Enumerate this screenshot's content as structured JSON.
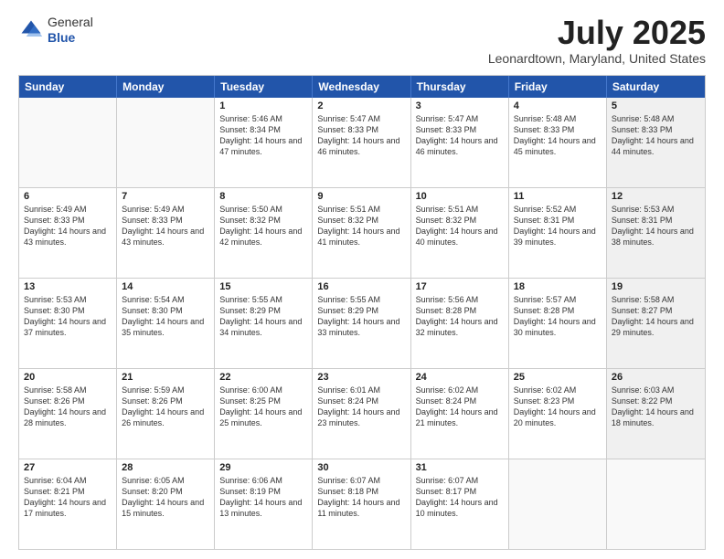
{
  "logo": {
    "general": "General",
    "blue": "Blue"
  },
  "title": {
    "month": "July 2025",
    "location": "Leonardtown, Maryland, United States"
  },
  "header_days": [
    "Sunday",
    "Monday",
    "Tuesday",
    "Wednesday",
    "Thursday",
    "Friday",
    "Saturday"
  ],
  "weeks": [
    [
      {
        "day": "",
        "sunrise": "",
        "sunset": "",
        "daylight": "",
        "empty": true
      },
      {
        "day": "",
        "sunrise": "",
        "sunset": "",
        "daylight": "",
        "empty": true
      },
      {
        "day": "1",
        "sunrise": "Sunrise: 5:46 AM",
        "sunset": "Sunset: 8:34 PM",
        "daylight": "Daylight: 14 hours and 47 minutes.",
        "empty": false,
        "shaded": false
      },
      {
        "day": "2",
        "sunrise": "Sunrise: 5:47 AM",
        "sunset": "Sunset: 8:33 PM",
        "daylight": "Daylight: 14 hours and 46 minutes.",
        "empty": false,
        "shaded": false
      },
      {
        "day": "3",
        "sunrise": "Sunrise: 5:47 AM",
        "sunset": "Sunset: 8:33 PM",
        "daylight": "Daylight: 14 hours and 46 minutes.",
        "empty": false,
        "shaded": false
      },
      {
        "day": "4",
        "sunrise": "Sunrise: 5:48 AM",
        "sunset": "Sunset: 8:33 PM",
        "daylight": "Daylight: 14 hours and 45 minutes.",
        "empty": false,
        "shaded": false
      },
      {
        "day": "5",
        "sunrise": "Sunrise: 5:48 AM",
        "sunset": "Sunset: 8:33 PM",
        "daylight": "Daylight: 14 hours and 44 minutes.",
        "empty": false,
        "shaded": true
      }
    ],
    [
      {
        "day": "6",
        "sunrise": "Sunrise: 5:49 AM",
        "sunset": "Sunset: 8:33 PM",
        "daylight": "Daylight: 14 hours and 43 minutes.",
        "empty": false,
        "shaded": false
      },
      {
        "day": "7",
        "sunrise": "Sunrise: 5:49 AM",
        "sunset": "Sunset: 8:33 PM",
        "daylight": "Daylight: 14 hours and 43 minutes.",
        "empty": false,
        "shaded": false
      },
      {
        "day": "8",
        "sunrise": "Sunrise: 5:50 AM",
        "sunset": "Sunset: 8:32 PM",
        "daylight": "Daylight: 14 hours and 42 minutes.",
        "empty": false,
        "shaded": false
      },
      {
        "day": "9",
        "sunrise": "Sunrise: 5:51 AM",
        "sunset": "Sunset: 8:32 PM",
        "daylight": "Daylight: 14 hours and 41 minutes.",
        "empty": false,
        "shaded": false
      },
      {
        "day": "10",
        "sunrise": "Sunrise: 5:51 AM",
        "sunset": "Sunset: 8:32 PM",
        "daylight": "Daylight: 14 hours and 40 minutes.",
        "empty": false,
        "shaded": false
      },
      {
        "day": "11",
        "sunrise": "Sunrise: 5:52 AM",
        "sunset": "Sunset: 8:31 PM",
        "daylight": "Daylight: 14 hours and 39 minutes.",
        "empty": false,
        "shaded": false
      },
      {
        "day": "12",
        "sunrise": "Sunrise: 5:53 AM",
        "sunset": "Sunset: 8:31 PM",
        "daylight": "Daylight: 14 hours and 38 minutes.",
        "empty": false,
        "shaded": true
      }
    ],
    [
      {
        "day": "13",
        "sunrise": "Sunrise: 5:53 AM",
        "sunset": "Sunset: 8:30 PM",
        "daylight": "Daylight: 14 hours and 37 minutes.",
        "empty": false,
        "shaded": false
      },
      {
        "day": "14",
        "sunrise": "Sunrise: 5:54 AM",
        "sunset": "Sunset: 8:30 PM",
        "daylight": "Daylight: 14 hours and 35 minutes.",
        "empty": false,
        "shaded": false
      },
      {
        "day": "15",
        "sunrise": "Sunrise: 5:55 AM",
        "sunset": "Sunset: 8:29 PM",
        "daylight": "Daylight: 14 hours and 34 minutes.",
        "empty": false,
        "shaded": false
      },
      {
        "day": "16",
        "sunrise": "Sunrise: 5:55 AM",
        "sunset": "Sunset: 8:29 PM",
        "daylight": "Daylight: 14 hours and 33 minutes.",
        "empty": false,
        "shaded": false
      },
      {
        "day": "17",
        "sunrise": "Sunrise: 5:56 AM",
        "sunset": "Sunset: 8:28 PM",
        "daylight": "Daylight: 14 hours and 32 minutes.",
        "empty": false,
        "shaded": false
      },
      {
        "day": "18",
        "sunrise": "Sunrise: 5:57 AM",
        "sunset": "Sunset: 8:28 PM",
        "daylight": "Daylight: 14 hours and 30 minutes.",
        "empty": false,
        "shaded": false
      },
      {
        "day": "19",
        "sunrise": "Sunrise: 5:58 AM",
        "sunset": "Sunset: 8:27 PM",
        "daylight": "Daylight: 14 hours and 29 minutes.",
        "empty": false,
        "shaded": true
      }
    ],
    [
      {
        "day": "20",
        "sunrise": "Sunrise: 5:58 AM",
        "sunset": "Sunset: 8:26 PM",
        "daylight": "Daylight: 14 hours and 28 minutes.",
        "empty": false,
        "shaded": false
      },
      {
        "day": "21",
        "sunrise": "Sunrise: 5:59 AM",
        "sunset": "Sunset: 8:26 PM",
        "daylight": "Daylight: 14 hours and 26 minutes.",
        "empty": false,
        "shaded": false
      },
      {
        "day": "22",
        "sunrise": "Sunrise: 6:00 AM",
        "sunset": "Sunset: 8:25 PM",
        "daylight": "Daylight: 14 hours and 25 minutes.",
        "empty": false,
        "shaded": false
      },
      {
        "day": "23",
        "sunrise": "Sunrise: 6:01 AM",
        "sunset": "Sunset: 8:24 PM",
        "daylight": "Daylight: 14 hours and 23 minutes.",
        "empty": false,
        "shaded": false
      },
      {
        "day": "24",
        "sunrise": "Sunrise: 6:02 AM",
        "sunset": "Sunset: 8:24 PM",
        "daylight": "Daylight: 14 hours and 21 minutes.",
        "empty": false,
        "shaded": false
      },
      {
        "day": "25",
        "sunrise": "Sunrise: 6:02 AM",
        "sunset": "Sunset: 8:23 PM",
        "daylight": "Daylight: 14 hours and 20 minutes.",
        "empty": false,
        "shaded": false
      },
      {
        "day": "26",
        "sunrise": "Sunrise: 6:03 AM",
        "sunset": "Sunset: 8:22 PM",
        "daylight": "Daylight: 14 hours and 18 minutes.",
        "empty": false,
        "shaded": true
      }
    ],
    [
      {
        "day": "27",
        "sunrise": "Sunrise: 6:04 AM",
        "sunset": "Sunset: 8:21 PM",
        "daylight": "Daylight: 14 hours and 17 minutes.",
        "empty": false,
        "shaded": false
      },
      {
        "day": "28",
        "sunrise": "Sunrise: 6:05 AM",
        "sunset": "Sunset: 8:20 PM",
        "daylight": "Daylight: 14 hours and 15 minutes.",
        "empty": false,
        "shaded": false
      },
      {
        "day": "29",
        "sunrise": "Sunrise: 6:06 AM",
        "sunset": "Sunset: 8:19 PM",
        "daylight": "Daylight: 14 hours and 13 minutes.",
        "empty": false,
        "shaded": false
      },
      {
        "day": "30",
        "sunrise": "Sunrise: 6:07 AM",
        "sunset": "Sunset: 8:18 PM",
        "daylight": "Daylight: 14 hours and 11 minutes.",
        "empty": false,
        "shaded": false
      },
      {
        "day": "31",
        "sunrise": "Sunrise: 6:07 AM",
        "sunset": "Sunset: 8:17 PM",
        "daylight": "Daylight: 14 hours and 10 minutes.",
        "empty": false,
        "shaded": false
      },
      {
        "day": "",
        "sunrise": "",
        "sunset": "",
        "daylight": "",
        "empty": true
      },
      {
        "day": "",
        "sunrise": "",
        "sunset": "",
        "daylight": "",
        "empty": true,
        "shaded": true
      }
    ]
  ]
}
